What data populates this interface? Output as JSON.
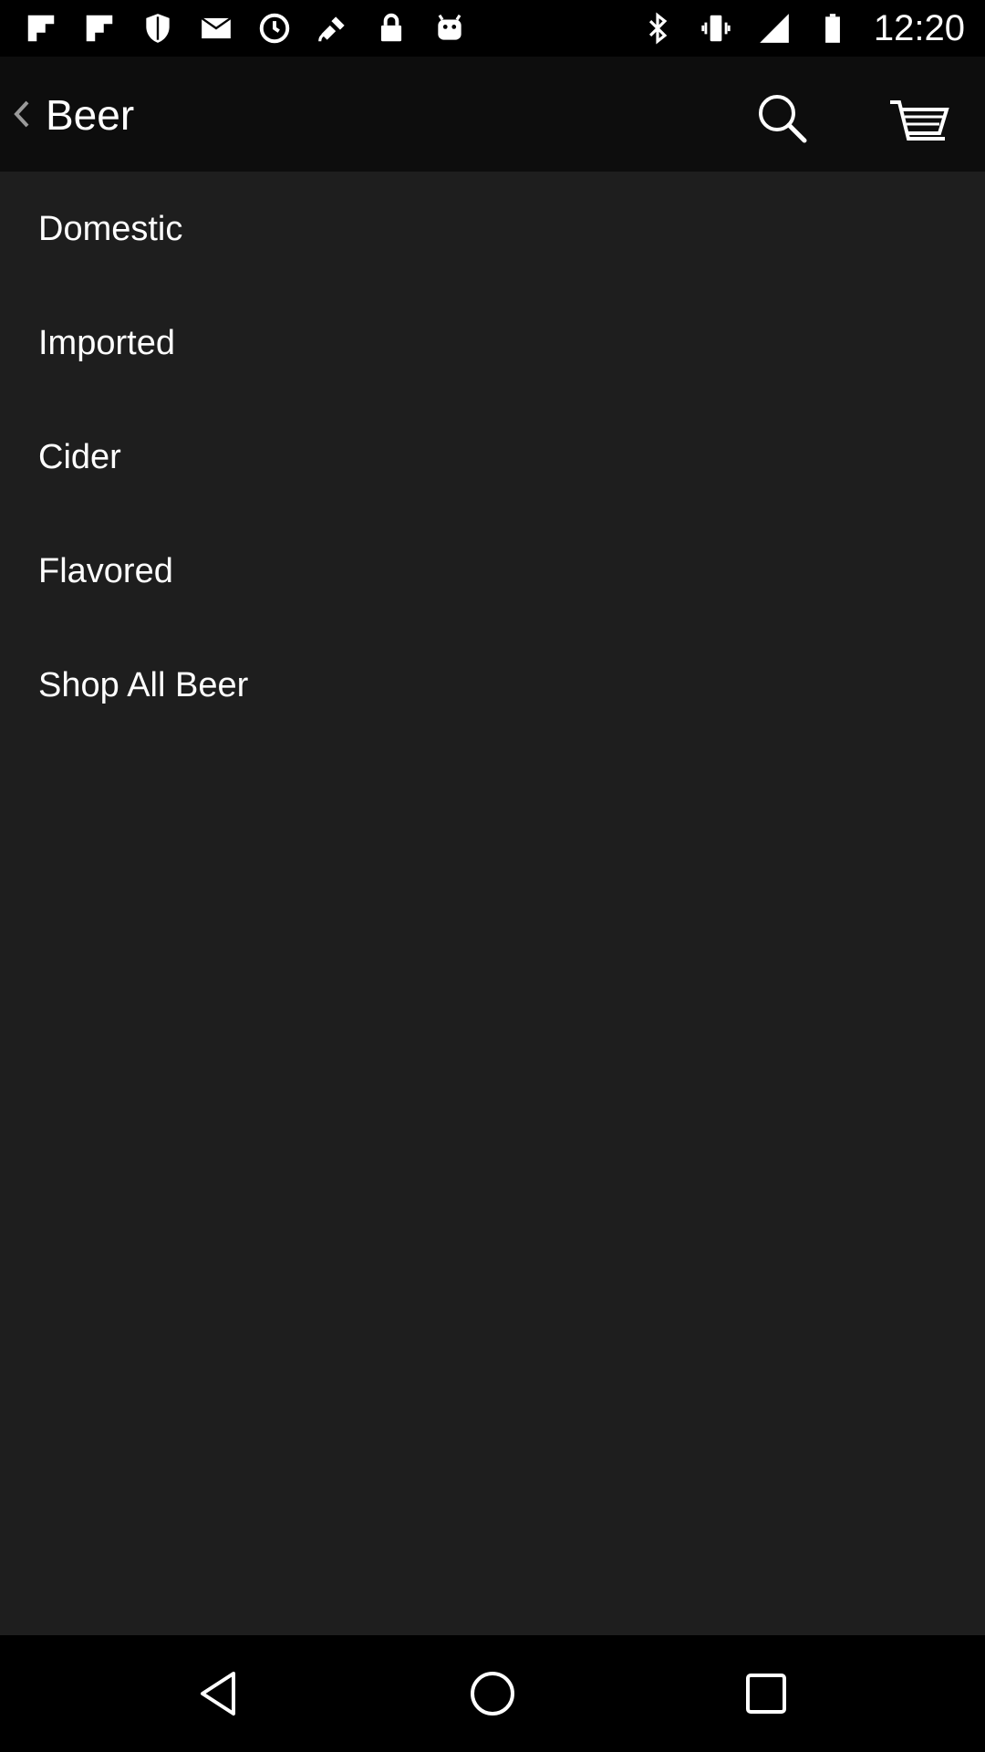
{
  "status_bar": {
    "time": "12:20",
    "icons_left": [
      "flipboard-icon",
      "flipboard-icon",
      "shield-icon",
      "mail-icon",
      "clock-icon",
      "satellite-fake-gps-icon",
      "lock-icon",
      "android-icon"
    ],
    "icons_right": [
      "bluetooth-icon",
      "vibrate-icon",
      "signal-icon",
      "battery-icon"
    ]
  },
  "app_bar": {
    "title": "Beer",
    "icons": [
      "back-chevron-icon",
      "search-icon",
      "cart-icon"
    ]
  },
  "menu": {
    "items": [
      {
        "label": "Domestic"
      },
      {
        "label": "Imported"
      },
      {
        "label": "Cider"
      },
      {
        "label": "Flavored"
      },
      {
        "label": "Shop All Beer"
      }
    ]
  },
  "nav_bar": {
    "icons": [
      "back-triangle-icon",
      "home-circle-icon",
      "recent-apps-square-icon"
    ]
  },
  "colors": {
    "status_bar_bg": "#000000",
    "app_bar_bg": "#0d0d0d",
    "content_bg": "#1e1e1e",
    "text": "#ffffff"
  }
}
